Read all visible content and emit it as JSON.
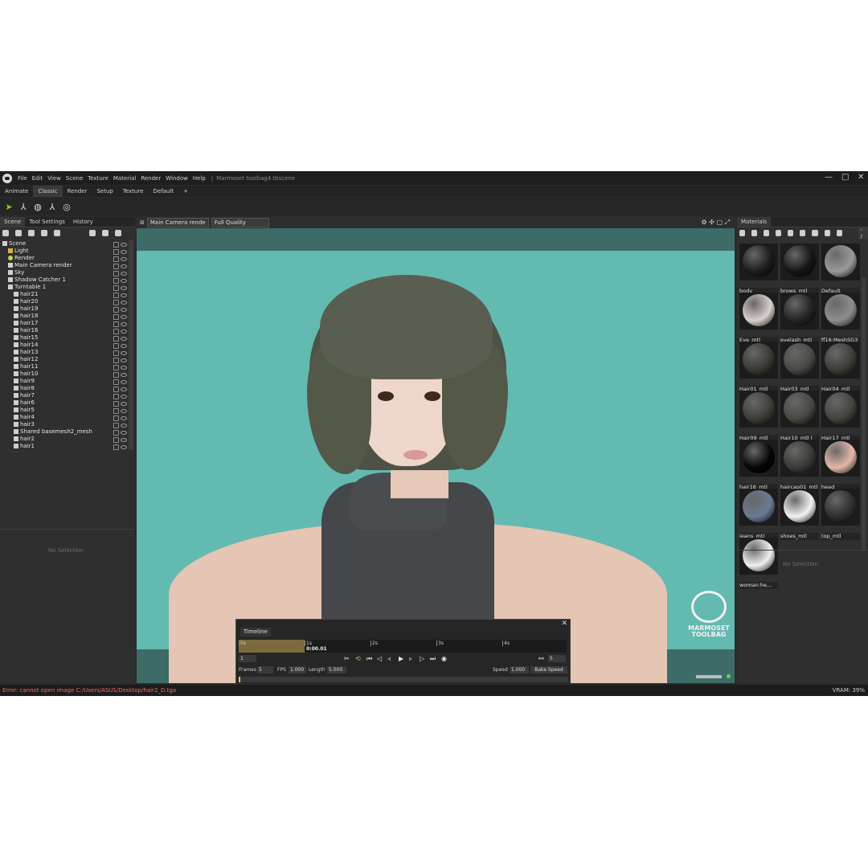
{
  "menubar": {
    "items": [
      "File",
      "Edit",
      "View",
      "Scene",
      "Texture",
      "Material",
      "Render",
      "Window",
      "Help"
    ],
    "separator": "|",
    "title": "Marmoset toolbag4.tbscene",
    "controls": [
      "—",
      "□",
      "✕"
    ]
  },
  "workspace_tabs": [
    "Animate",
    "Classic",
    "Render",
    "Setup",
    "Texture",
    "Default",
    "+"
  ],
  "active_workspace": "Classic",
  "left_panel": {
    "tabs": [
      "Scene",
      "Tool Settings",
      "History"
    ],
    "tree": [
      {
        "label": "Scene",
        "indent": 0,
        "icon": "scene"
      },
      {
        "label": "Light",
        "indent": 1,
        "icon": "folder"
      },
      {
        "label": "Render",
        "indent": 1,
        "icon": "light"
      },
      {
        "label": "Main Camera render",
        "indent": 1,
        "icon": "camera"
      },
      {
        "label": "Sky",
        "indent": 1,
        "icon": "sky"
      },
      {
        "label": "Shadow Catcher 1",
        "indent": 1,
        "icon": "shadow"
      },
      {
        "label": "Turntable 1",
        "indent": 1,
        "icon": "turntable"
      },
      {
        "label": "hair21",
        "indent": 2,
        "icon": "mesh"
      },
      {
        "label": "hair20",
        "indent": 2,
        "icon": "mesh"
      },
      {
        "label": "hair19",
        "indent": 2,
        "icon": "mesh"
      },
      {
        "label": "hair18",
        "indent": 2,
        "icon": "mesh"
      },
      {
        "label": "hair17",
        "indent": 2,
        "icon": "mesh"
      },
      {
        "label": "hair16",
        "indent": 2,
        "icon": "mesh"
      },
      {
        "label": "hair15",
        "indent": 2,
        "icon": "mesh"
      },
      {
        "label": "hair14",
        "indent": 2,
        "icon": "mesh"
      },
      {
        "label": "hair13",
        "indent": 2,
        "icon": "mesh"
      },
      {
        "label": "hair12",
        "indent": 2,
        "icon": "mesh"
      },
      {
        "label": "hair11",
        "indent": 2,
        "icon": "mesh"
      },
      {
        "label": "hair10",
        "indent": 2,
        "icon": "mesh"
      },
      {
        "label": "hair9",
        "indent": 2,
        "icon": "mesh"
      },
      {
        "label": "hair8",
        "indent": 2,
        "icon": "mesh"
      },
      {
        "label": "hair7",
        "indent": 2,
        "icon": "mesh"
      },
      {
        "label": "hair6",
        "indent": 2,
        "icon": "mesh"
      },
      {
        "label": "hair5",
        "indent": 2,
        "icon": "mesh"
      },
      {
        "label": "hair4",
        "indent": 2,
        "icon": "mesh"
      },
      {
        "label": "hair3",
        "indent": 2,
        "icon": "mesh"
      },
      {
        "label": "Shared basemesh2_mesh",
        "indent": 2,
        "icon": "mesh"
      },
      {
        "label": "hair2",
        "indent": 2,
        "icon": "mesh"
      },
      {
        "label": "hair1",
        "indent": 2,
        "icon": "mesh"
      }
    ],
    "no_selection": "No Selection"
  },
  "viewport": {
    "camera_select": "Main Camera rende",
    "quality_select": "Full Quality",
    "logo_line1": "MARMOSET",
    "logo_line2": "TOOLBAG"
  },
  "timeline": {
    "title": "Timeline",
    "close": "✕",
    "ticks": [
      "0s",
      "1s",
      "2s",
      "3s",
      "4s"
    ],
    "current_time": "0:00.01",
    "frame_field": "1",
    "link_value": "5",
    "frames_label": "Frames",
    "frames_value": "5",
    "fps_label": "FPS",
    "fps_value": "1.000",
    "length_label": "Length",
    "length_value": "5.000",
    "speed_label": "Speed",
    "speed_value": "1.000",
    "bake_speed": "Bake Speed"
  },
  "right_panel": {
    "tab": "Materials",
    "filter": "- /",
    "materials": [
      {
        "name": "body",
        "color": "#1c1c1c"
      },
      {
        "name": "brows_mtl",
        "color": "#151515"
      },
      {
        "name": "Default",
        "color": "#9a9a9a"
      },
      {
        "name": "Eye_mtl",
        "color": "#d8d0cc"
      },
      {
        "name": "eyelash_mtl",
        "color": "#222222"
      },
      {
        "name": "ff16:MeshSG3",
        "color": "#8e8e8e"
      },
      {
        "name": "Hair01_mtl",
        "color": "#3a3a34"
      },
      {
        "name": "Hair03_mtl",
        "color": "#4a4a44"
      },
      {
        "name": "Hair04_mtl",
        "color": "#3e3e38"
      },
      {
        "name": "Hair09_mtl",
        "color": "#3e3e38"
      },
      {
        "name": "Hair10_mtl (",
        "color": "#484842"
      },
      {
        "name": "Hair17_mtl",
        "color": "#44443e"
      },
      {
        "name": "hair16_mtl",
        "color": "#050505"
      },
      {
        "name": "haircap01_mtl",
        "color": "#3a3a36"
      },
      {
        "name": "head",
        "color": "#e2b8aa"
      },
      {
        "name": "jeans_mtl",
        "color": "#6a7a94"
      },
      {
        "name": "shoes_mtl",
        "color": "#f2f2f2"
      },
      {
        "name": "top_mtl",
        "color": "#2e2e2e"
      },
      {
        "name": "woman:he...",
        "color": "#f0f0f0"
      }
    ],
    "no_selection": "No Selection"
  },
  "status": {
    "error": "Error: cannot open image C:/Users/ASUS/Desktop/hair2_D.tga",
    "vram": "VRAM: 39%"
  }
}
